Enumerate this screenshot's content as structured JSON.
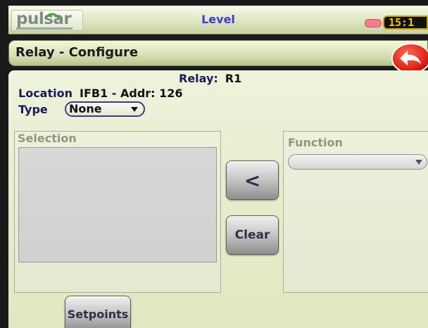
{
  "status_bar": {
    "logo": {
      "word": "pulsar",
      "icon": "pulsar-logo"
    },
    "page_name": "Level",
    "clock": "15:1",
    "status_indicator_color": "#f07c8c"
  },
  "title_bar": {
    "title": "Relay - Configure",
    "back_icon": "back-arrow-icon"
  },
  "relay": {
    "label": "Relay:",
    "value": "R1"
  },
  "location": {
    "label": "Location",
    "value": "IFB1 - Addr: 126"
  },
  "type": {
    "label": "Type",
    "selected": "None"
  },
  "selection": {
    "label": "Selection",
    "items": []
  },
  "function": {
    "label": "Function",
    "selected": ""
  },
  "buttons": {
    "move_left": "<",
    "clear": "Clear",
    "setpoints": "Setpoints"
  },
  "colors": {
    "title_text": "#3b3bd8",
    "label_text": "#1a1a5a",
    "clock_text": "#f0c400",
    "back_button": "#e8321e"
  }
}
